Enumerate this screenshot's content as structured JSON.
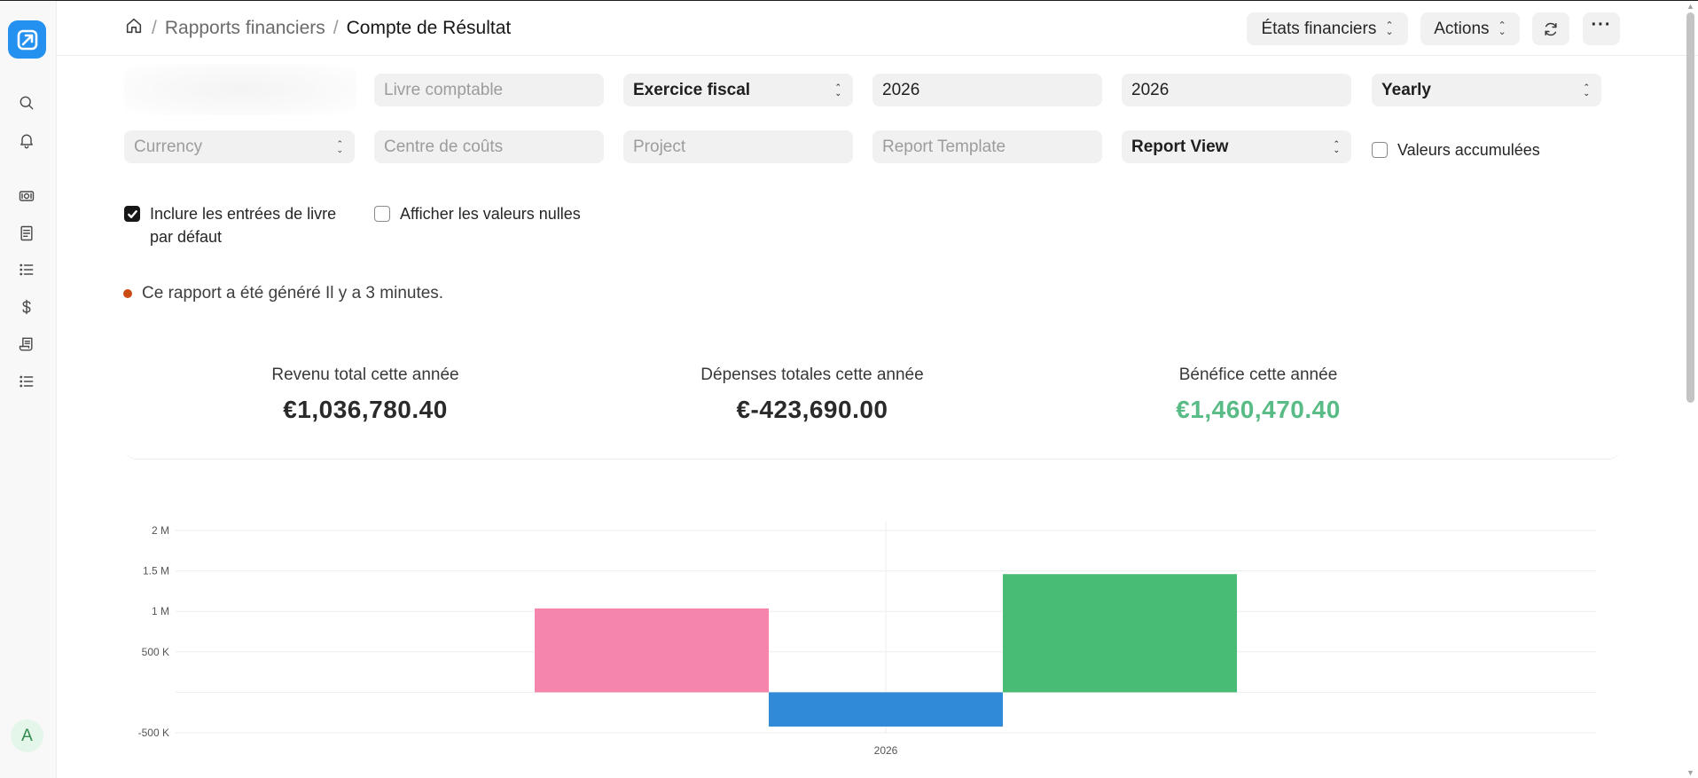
{
  "breadcrumb": {
    "parent": "Rapports financiers",
    "current": "Compte de Résultat",
    "separator": "/"
  },
  "header": {
    "financial_statements_label": "États financiers",
    "actions_label": "Actions"
  },
  "filters": {
    "ledger_placeholder": "Livre comptable",
    "period_type": "Exercice fiscal",
    "from_year": "2026",
    "to_year": "2026",
    "periodicity": "Yearly",
    "currency_placeholder": "Currency",
    "cost_center_placeholder": "Centre de coûts",
    "project_placeholder": "Project",
    "report_template_placeholder": "Report Template",
    "report_view": "Report View",
    "accumulated_values_label": "Valeurs accumulées",
    "accumulated_values_checked": false,
    "include_default_book_label_line1": "Inclure les entrées de livre",
    "include_default_book_label_line2": "par défaut",
    "include_default_book_checked": true,
    "show_zero_values_label": "Afficher les valeurs nulles",
    "show_zero_values_checked": false
  },
  "status": {
    "message": "Ce rapport a été généré Il y a 3 minutes.",
    "dot_color": "#cc4a15"
  },
  "summary": {
    "income_label": "Revenu total cette année",
    "income_value": "€1,036,780.40",
    "expense_label": "Dépenses totales cette année",
    "expense_value": "€-423,690.00",
    "profit_label": "Bénéfice cette année",
    "profit_value": "€1,460,470.40",
    "profit_color": "#59bb85"
  },
  "user": {
    "avatar_initial": "A"
  },
  "icons": {
    "logo": "app-logo-icon",
    "sidebar": [
      "search-icon",
      "bell-icon",
      "money-icon",
      "book-icon",
      "list-icon",
      "dollar-icon",
      "receipt-icon",
      "list-icon"
    ]
  },
  "chart_data": {
    "type": "bar",
    "categories": [
      "2026"
    ],
    "series": [
      {
        "values": [
          1036780.4
        ],
        "color": "#f585ad"
      },
      {
        "values": [
          -423690.0
        ],
        "color": "#318ad8"
      },
      {
        "values": [
          1460470.4
        ],
        "color": "#48bb74"
      }
    ],
    "yticks": [
      {
        "value": 2000000,
        "label": "2 M"
      },
      {
        "value": 1500000,
        "label": "1.5 M"
      },
      {
        "value": 1000000,
        "label": "1 M"
      },
      {
        "value": 500000,
        "label": "500 K"
      },
      {
        "value": 0,
        "label": ""
      },
      {
        "value": -500000,
        "label": "-500 K"
      }
    ],
    "ylim": [
      -500000,
      2000000
    ],
    "grid": true
  }
}
